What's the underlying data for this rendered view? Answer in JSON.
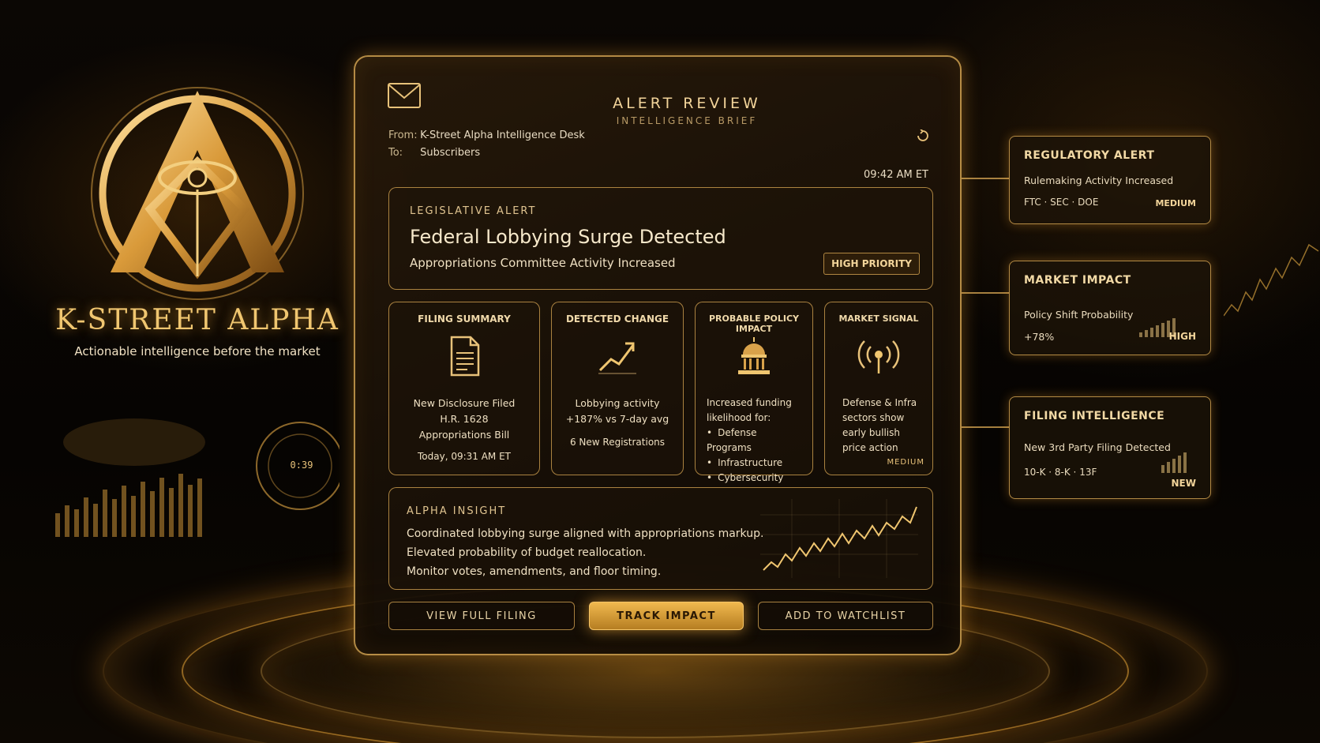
{
  "brand": {
    "name": "K-STREET ALPHA",
    "tagline": "Actionable intelligence before the market",
    "gauge_readout": "0:39"
  },
  "panel": {
    "title": "ALERT REVIEW",
    "subtitle": "INTELLIGENCE BRIEF",
    "from_label": "From:",
    "from_value": "K-Street Alpha Intelligence Desk",
    "to_label": "To:",
    "to_value": "Subscribers",
    "time": "09:42 AM ET"
  },
  "alert": {
    "kicker": "LEGISLATIVE ALERT",
    "title": "Federal Lobbying Surge Detected",
    "subtitle": "Appropriations Committee Activity Increased",
    "priority": "HIGH PRIORITY"
  },
  "cards": [
    {
      "title": "FILING SUMMARY",
      "icon": "document-icon",
      "lines": [
        "New Disclosure Filed",
        "H.R. 1628",
        "Appropriations Bill"
      ],
      "footer": "Today, 09:31 AM ET"
    },
    {
      "title": "DETECTED CHANGE",
      "icon": "trend-up-icon",
      "lines": [
        "Lobbying activity",
        "+187% vs 7-day avg"
      ],
      "footer": "6 New Registrations"
    },
    {
      "title": "PROBABLE POLICY IMPACT",
      "icon": "capitol-icon",
      "intro": [
        "Increased funding",
        "likelihood for:"
      ],
      "bullets": [
        "Defense Programs",
        "Infrastructure",
        "Cybersecurity"
      ]
    },
    {
      "title": "MARKET SIGNAL",
      "icon": "signal-icon",
      "lines": [
        "Defense & Infra",
        "sectors show",
        "early bullish",
        "price action"
      ],
      "badge": "MEDIUM"
    }
  ],
  "insight": {
    "kicker": "ALPHA INSIGHT",
    "lines": [
      "Coordinated lobbying surge aligned with appropriations markup.",
      "Elevated probability of budget reallocation.",
      "Monitor votes, amendments, and floor timing."
    ]
  },
  "actions": {
    "view": "VIEW FULL FILING",
    "track": "TRACK IMPACT",
    "watch": "ADD TO WATCHLIST"
  },
  "side": {
    "regulatory": {
      "title": "REGULATORY ALERT",
      "line1": "Rulemaking Activity Increased",
      "line2": "FTC · SEC · DOE",
      "badge": "MEDIUM"
    },
    "market": {
      "title": "MARKET IMPACT",
      "line1": "Policy Shift Probability",
      "line2": "+78%",
      "badge": "HIGH"
    },
    "filing": {
      "title": "FILING INTELLIGENCE",
      "line1": "New 3rd Party Filing Detected",
      "line2": "10-K · 8-K · 13F",
      "badge": "NEW"
    }
  },
  "colors": {
    "gold": "#e8b45a",
    "gold_bright": "#f5c467",
    "text": "#efe0c2",
    "background": "#050302"
  }
}
